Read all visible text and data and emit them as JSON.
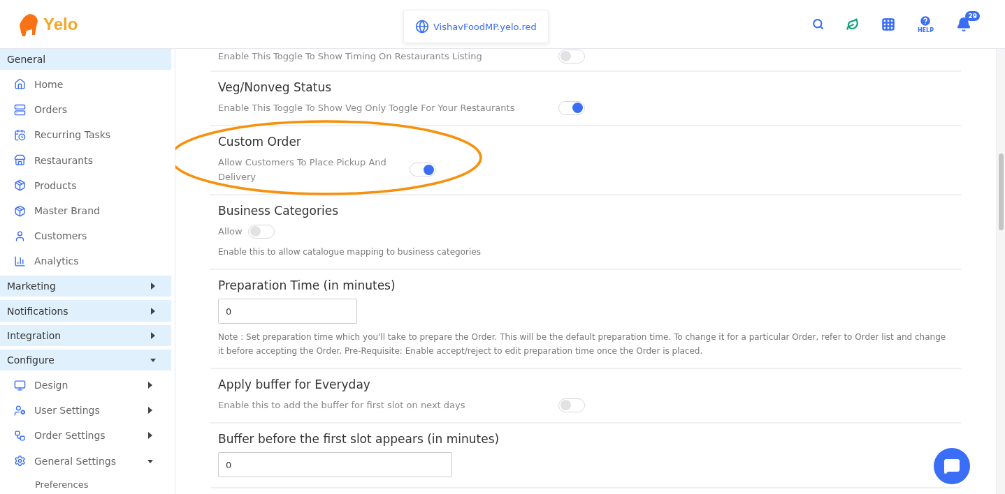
{
  "header": {
    "logo_text": "Yelo",
    "domain": "VishavFoodMP.yelo.red",
    "help_label": "HELP",
    "notification_count": "29"
  },
  "sidebar": {
    "groups": [
      {
        "label": "General",
        "expanded": true,
        "kind": "plain",
        "items": [
          {
            "label": "Home"
          },
          {
            "label": "Orders"
          },
          {
            "label": "Recurring Tasks"
          },
          {
            "label": "Restaurants"
          },
          {
            "label": "Products"
          },
          {
            "label": "Master Brand"
          },
          {
            "label": "Customers"
          },
          {
            "label": "Analytics"
          }
        ]
      },
      {
        "label": "Marketing",
        "expanded": false,
        "kind": "caret"
      },
      {
        "label": "Notifications",
        "expanded": false,
        "kind": "caret"
      },
      {
        "label": "Integration",
        "expanded": false,
        "kind": "caret"
      },
      {
        "label": "Configure",
        "expanded": true,
        "kind": "caret",
        "items": [
          {
            "label": "Design",
            "expanded": false
          },
          {
            "label": "User Settings",
            "expanded": false
          },
          {
            "label": "Order Settings",
            "expanded": false
          },
          {
            "label": "General Settings",
            "expanded": true,
            "children": [
              {
                "label": "Preferences"
              }
            ]
          }
        ]
      }
    ]
  },
  "sections": [
    {
      "kind": "toggle",
      "description": "Enable This Toggle To Show Timing On Restaurants Listing",
      "on": false
    },
    {
      "kind": "toggle",
      "title": "Veg/Nonveg Status",
      "description": "Enable This Toggle To Show Veg Only Toggle For Your Restaurants",
      "on": true
    },
    {
      "kind": "toggle",
      "title": "Custom Order",
      "description": "Allow Customers To Place Pickup And Delivery",
      "on": true,
      "circled": true
    },
    {
      "kind": "labeled_toggle",
      "title": "Business Categories",
      "label": "Allow",
      "on": false,
      "note": "Enable this to allow catalogue mapping to business categories"
    },
    {
      "kind": "input",
      "title": "Preparation Time (in minutes)",
      "value": "0",
      "note": "Note : Set preparation time which you'll take to prepare the Order. This will be the default preparation time. To change it for a particular Order, refer to Order list and change it before accepting the Order. Pre-Requisite: Enable accept/reject to edit preparation time once the Order is placed."
    },
    {
      "kind": "toggle",
      "title": "Apply buffer for Everyday",
      "description": "Enable this to add the buffer for first slot on next days",
      "on": false
    },
    {
      "kind": "input",
      "title": "Buffer before the first slot appears (in minutes)",
      "value": "0"
    }
  ]
}
